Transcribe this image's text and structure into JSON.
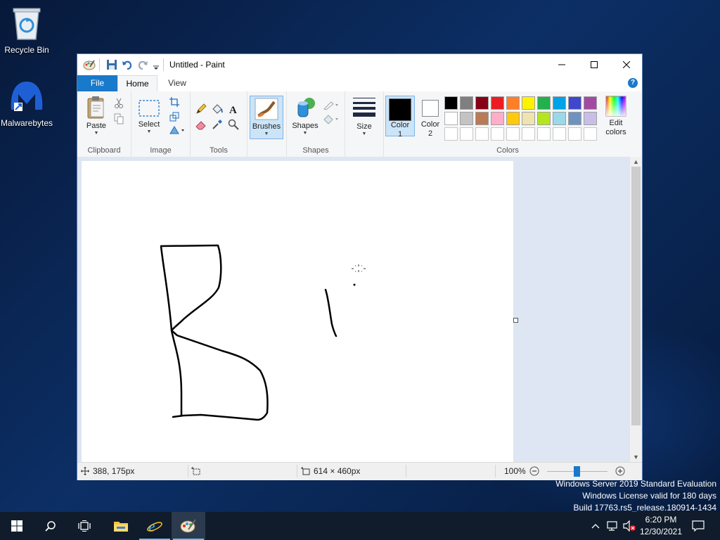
{
  "desktop": {
    "icons": [
      {
        "label": "Recycle Bin",
        "icon": "recycle-bin-icon"
      },
      {
        "label": "Malwarebytes",
        "icon": "malwarebytes-icon"
      }
    ]
  },
  "window": {
    "title": "Untitled - Paint",
    "tabs": {
      "file": "File",
      "home": "Home",
      "view": "View"
    },
    "help_label": "?"
  },
  "ribbon": {
    "clipboard": {
      "title": "Clipboard",
      "paste": "Paste"
    },
    "image": {
      "title": "Image",
      "select": "Select"
    },
    "tools": {
      "title": "Tools"
    },
    "brushes": {
      "label": "Brushes"
    },
    "shapes": {
      "title": "Shapes",
      "label": "Shapes"
    },
    "size": {
      "label": "Size"
    },
    "colors": {
      "title": "Colors",
      "color1": "Color",
      "color1_num": "1",
      "color2": "Color",
      "color2_num": "2",
      "edit": "Edit",
      "edit2": "colors",
      "color1_value": "#000000",
      "color2_value": "#ffffff",
      "palette_row1": [
        "#000000",
        "#7f7f7f",
        "#880015",
        "#ed1c24",
        "#ff7f27",
        "#fff200",
        "#22b14c",
        "#00a2e8",
        "#3f48cc",
        "#a349a4"
      ],
      "palette_row2": [
        "#ffffff",
        "#c3c3c3",
        "#b97a57",
        "#ffaec9",
        "#ffc90e",
        "#efe4b0",
        "#b5e61d",
        "#99d9ea",
        "#7092be",
        "#c8bfe7"
      ]
    }
  },
  "status": {
    "cursor_pos": "388, 175px",
    "canvas_size": "614 × 460px",
    "zoom": "100%"
  },
  "watermark": {
    "line1": "Windows Server 2019 Standard Evaluation",
    "line2": "Windows License valid for 180 days",
    "line3": "Build 17763.rs5_release.180914-1434"
  },
  "taskbar": {
    "time": "6:20 PM",
    "date": "12/30/2021"
  }
}
